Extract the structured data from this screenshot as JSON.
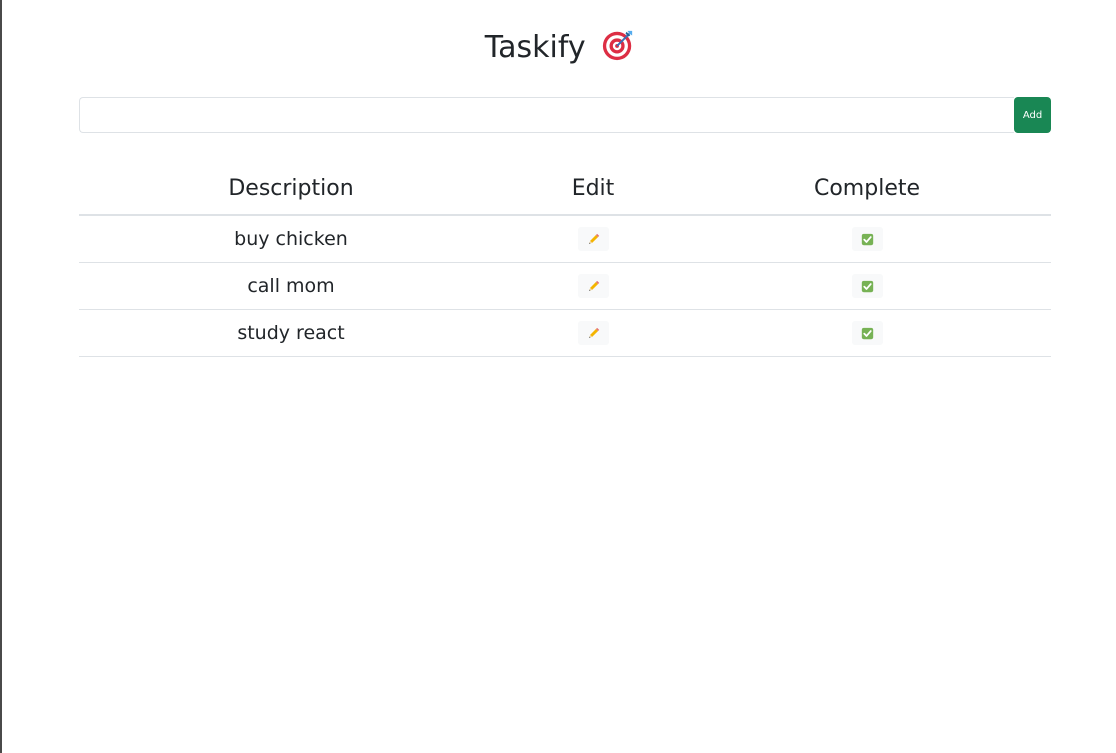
{
  "app": {
    "title": "Taskify",
    "title_icon": "target-icon"
  },
  "add_form": {
    "input_value": "",
    "input_placeholder": "",
    "add_label": "Add",
    "add_color": "#198754"
  },
  "table": {
    "headers": {
      "description": "Description",
      "edit": "Edit",
      "complete": "Complete"
    },
    "rows": [
      {
        "description": "buy chicken",
        "edit_icon": "pencil-icon",
        "complete_icon": "check-mark-button-icon"
      },
      {
        "description": "call mom",
        "edit_icon": "pencil-icon",
        "complete_icon": "check-mark-button-icon"
      },
      {
        "description": "study react",
        "edit_icon": "pencil-icon",
        "complete_icon": "check-mark-button-icon"
      }
    ]
  }
}
